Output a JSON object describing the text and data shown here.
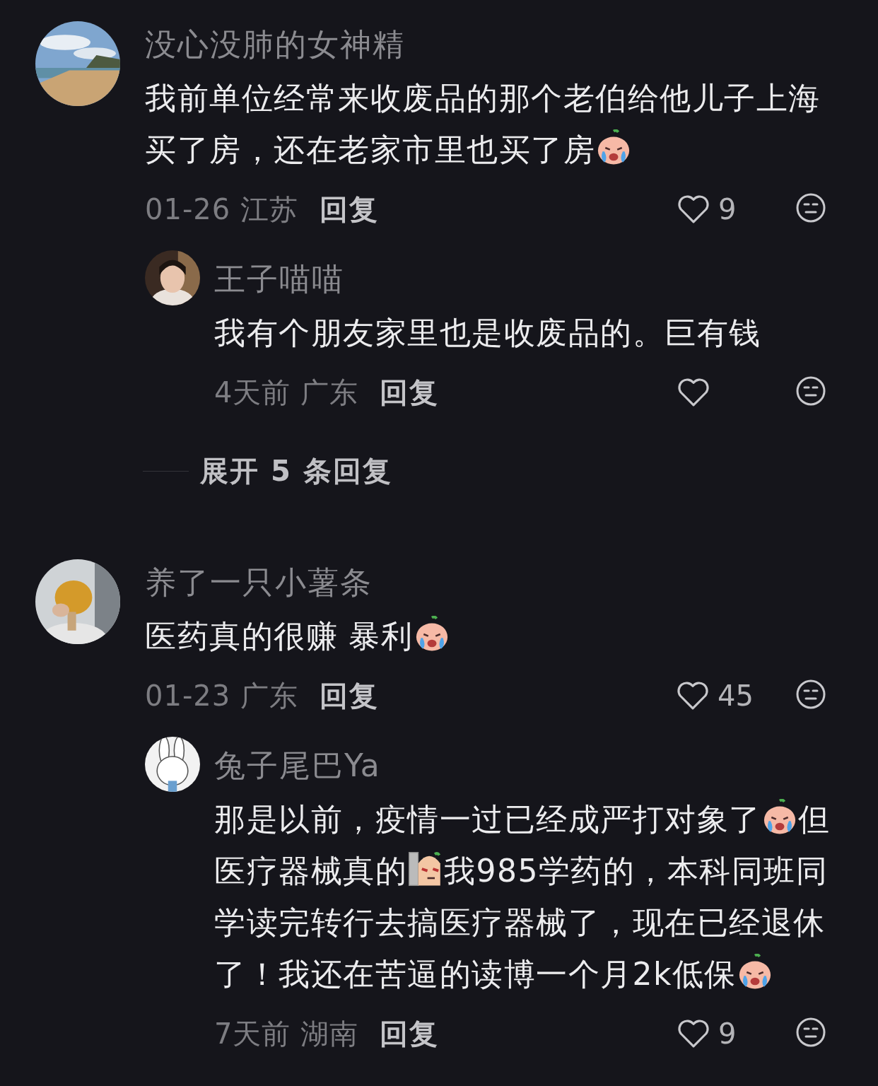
{
  "comments": [
    {
      "user": "没心没肺的女神精",
      "lines": [
        [
          {
            "kind": "text",
            "text": "我前单位经常来收废品的那个老伯给他儿子上海"
          }
        ],
        [
          {
            "kind": "text",
            "text": "买了房，还在老家市里也买了房"
          },
          {
            "kind": "crying-emoji"
          }
        ]
      ],
      "time": "01-26",
      "location": "江苏",
      "reply_label": "回复",
      "likes": "9",
      "replies": [
        {
          "user": "王子喵喵",
          "lines": [
            [
              {
                "kind": "text",
                "text": "我有个朋友家里也是收废品的。巨有钱"
              }
            ]
          ],
          "time": "4天前",
          "location": "广东",
          "reply_label": "回复"
        }
      ],
      "expand": "展开 5 条回复"
    },
    {
      "user": "养了一只小薯条",
      "lines": [
        [
          {
            "kind": "text",
            "text": "医药真的很赚 暴利"
          },
          {
            "kind": "crying-emoji"
          }
        ]
      ],
      "time": "01-23",
      "location": "广东",
      "reply_label": "回复",
      "likes": "45",
      "replies": [
        {
          "user": "兔子尾巴Ya",
          "lines": [
            [
              {
                "kind": "text",
                "text": "那是以前，疫情一过已经成严打对象了"
              },
              {
                "kind": "crying-emoji"
              },
              {
                "kind": "text",
                "text": "但"
              }
            ],
            [
              {
                "kind": "text",
                "text": "医疗器械真的"
              },
              {
                "kind": "wall-emoji"
              },
              {
                "kind": "text",
                "text": "我985学药的，本科同班同"
              }
            ],
            [
              {
                "kind": "text",
                "text": "学读完转行去搞医疗器械了，现在已经退休"
              }
            ],
            [
              {
                "kind": "text",
                "text": "了！我还在苦逼的读博一个月2k低保"
              },
              {
                "kind": "crying-emoji"
              }
            ]
          ],
          "time": "7天前",
          "location": "湖南",
          "reply_label": "回复",
          "likes": "9"
        }
      ]
    }
  ]
}
